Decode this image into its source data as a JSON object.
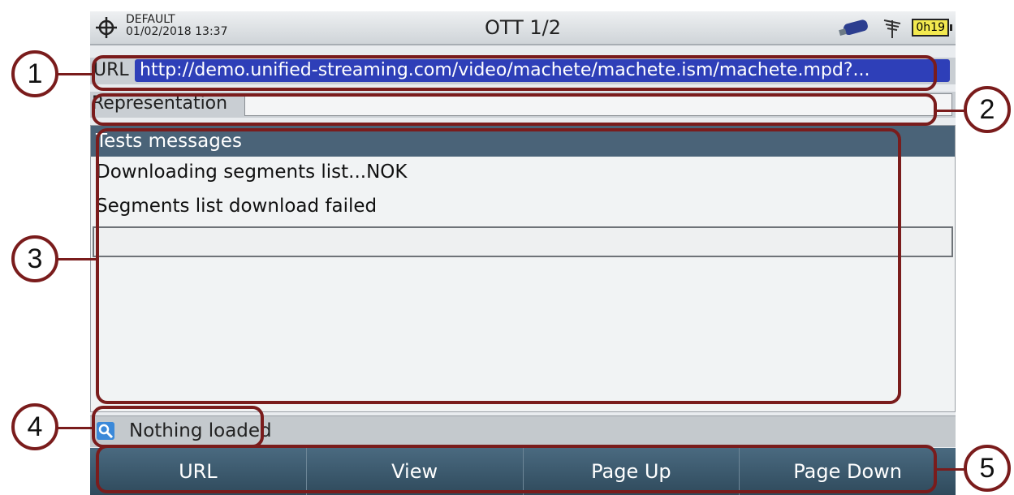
{
  "topbar": {
    "profile": "DEFAULT",
    "datetime": "01/02/2018 13:37",
    "title": "OTT 1/2",
    "battery": "0h19"
  },
  "url": {
    "label": "URL",
    "value": "http://demo.unified-streaming.com/video/machete/machete.ism/machete.mpd?..."
  },
  "representation": {
    "label": "Representation",
    "value": ""
  },
  "messages": {
    "header": "Tests messages",
    "items": [
      "Downloading segments list...NOK",
      "Segments list download failed"
    ]
  },
  "status": {
    "text": "Nothing loaded"
  },
  "softkeys": [
    "URL",
    "View",
    "Page Up",
    "Page Down"
  ],
  "callouts": [
    "1",
    "2",
    "3",
    "4",
    "5"
  ],
  "colors": {
    "callout": "#7a1c1c",
    "url_highlight": "#2e3fb8",
    "panel_header": "#4a6378"
  }
}
